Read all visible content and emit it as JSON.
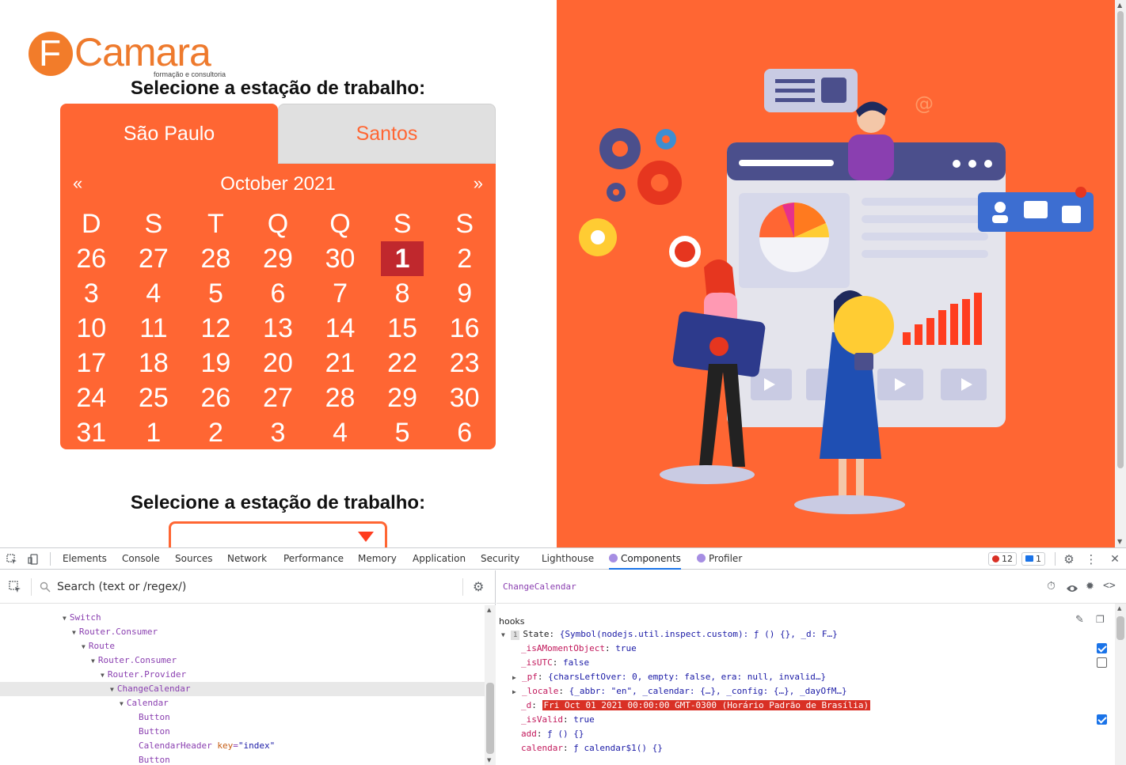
{
  "page": {
    "logo": {
      "word": "Camara",
      "letter": "F",
      "subtitle": "formação e consultoria"
    },
    "station_heading": "Selecione a estação de trabalho:",
    "station_heading_2": "Selecione a estação de trabalho:",
    "tabs": [
      {
        "label": "São Paulo",
        "active": true
      },
      {
        "label": "Santos",
        "active": false
      }
    ],
    "calendar": {
      "prev": "«",
      "next": "»",
      "month_title": "October 2021",
      "weekdays": [
        "D",
        "S",
        "T",
        "Q",
        "Q",
        "S",
        "S"
      ],
      "weeks": [
        [
          "26",
          "27",
          "28",
          "29",
          "30",
          "1",
          "2"
        ],
        [
          "3",
          "4",
          "5",
          "6",
          "7",
          "8",
          "9"
        ],
        [
          "10",
          "11",
          "12",
          "13",
          "14",
          "15",
          "16"
        ],
        [
          "17",
          "18",
          "19",
          "20",
          "21",
          "22",
          "23"
        ],
        [
          "24",
          "25",
          "26",
          "27",
          "28",
          "29",
          "30"
        ],
        [
          "31",
          "1",
          "2",
          "3",
          "4",
          "5",
          "6"
        ]
      ],
      "selected": "1"
    },
    "colors": {
      "accent": "#ff6633",
      "selected_day": "#c0282d",
      "tab_inactive": "#e0e0e0"
    }
  },
  "devtools": {
    "tabs": [
      {
        "label": "Elements"
      },
      {
        "label": "Console"
      },
      {
        "label": "Sources"
      },
      {
        "label": "Network"
      },
      {
        "label": "Performance"
      },
      {
        "label": "Memory"
      },
      {
        "label": "Application"
      },
      {
        "label": "Security"
      },
      {
        "label": "Lighthouse"
      },
      {
        "label": "Components",
        "active": true
      },
      {
        "label": "Profiler"
      }
    ],
    "errors_count": "12",
    "messages_count": "1",
    "search_placeholder": "Search (text or /regex/)",
    "tree": [
      {
        "name": "Switch",
        "depth": 0,
        "caret": true
      },
      {
        "name": "Router.Consumer",
        "depth": 1,
        "caret": true
      },
      {
        "name": "Route",
        "depth": 2,
        "caret": true
      },
      {
        "name": "Router.Consumer",
        "depth": 3,
        "caret": true
      },
      {
        "name": "Router.Provider",
        "depth": 4,
        "caret": true
      },
      {
        "name": "ChangeCalendar",
        "depth": 5,
        "caret": true,
        "selected": true
      },
      {
        "name": "Calendar",
        "depth": 6,
        "caret": true
      },
      {
        "name": "Button",
        "depth": 7,
        "caret": false
      },
      {
        "name": "Button",
        "depth": 7,
        "caret": false
      },
      {
        "name": "CalendarHeader",
        "depth": 7,
        "caret": false,
        "attr_key": "key",
        "attr_val": "\"index\""
      },
      {
        "name": "Button",
        "depth": 7,
        "caret": false
      }
    ],
    "selected_component": "ChangeCalendar",
    "hooks_label": "hooks",
    "hooks": {
      "state_index": "1",
      "state_label": "State:",
      "state_value": "{Symbol(nodejs.util.inspect.custom): ƒ () {}, _d: F…}",
      "rows": [
        {
          "key": "_isAMomentObject",
          "value": "true",
          "checkbox": "on"
        },
        {
          "key": "_isUTC",
          "value": "false",
          "checkbox": "off"
        },
        {
          "key": "_pf",
          "value": "{charsLeftOver: 0, empty: false, era: null, invalid…}",
          "caret": true
        },
        {
          "key": "_locale",
          "value": "{_abbr: \"en\", _calendar: {…}, _config: {…}, _dayOfM…}",
          "caret": true
        },
        {
          "key": "_d",
          "value": "Fri Oct 01 2021 00:00:00 GMT-0300 (Horário Padrão de Brasília)",
          "highlight": true
        },
        {
          "key": "_isValid",
          "value": "true",
          "checkbox": "on"
        },
        {
          "key": "add",
          "value": "ƒ () {}"
        },
        {
          "key": "calendar",
          "value": "ƒ calendar$1() {}"
        }
      ]
    }
  }
}
